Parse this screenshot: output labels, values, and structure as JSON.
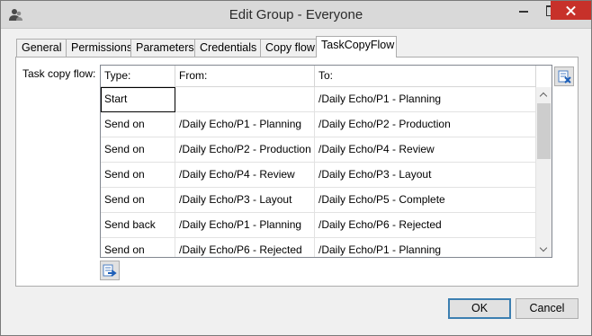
{
  "window": {
    "title": "Edit Group - Everyone"
  },
  "tabs": [
    {
      "label": "General"
    },
    {
      "label": "Permissions"
    },
    {
      "label": "Parameters"
    },
    {
      "label": "Credentials"
    },
    {
      "label": "Copy flow"
    },
    {
      "label": "TaskCopyFlow",
      "active": true
    }
  ],
  "task_copy_flow": {
    "label": "Task copy flow:",
    "columns": [
      "Type:",
      "From:",
      "To:"
    ],
    "rows": [
      {
        "type": "Start",
        "from": "",
        "to": "/Daily Echo/P1 - Planning"
      },
      {
        "type": "Send on",
        "from": "/Daily Echo/P1 - Planning",
        "to": "/Daily Echo/P2 - Production"
      },
      {
        "type": "Send on",
        "from": "/Daily Echo/P2 - Production",
        "to": "/Daily Echo/P4 - Review"
      },
      {
        "type": "Send on",
        "from": "/Daily Echo/P4 - Review",
        "to": "/Daily Echo/P3 - Layout"
      },
      {
        "type": "Send on",
        "from": "/Daily Echo/P3 - Layout",
        "to": "/Daily Echo/P5 - Complete"
      },
      {
        "type": "Send back",
        "from": "/Daily Echo/P1 - Planning",
        "to": "/Daily Echo/P6 - Rejected"
      },
      {
        "type": "Send on",
        "from": "/Daily Echo/P6 - Rejected",
        "to": "/Daily Echo/P1 - Planning"
      }
    ]
  },
  "icons": {
    "app": "users-icon",
    "delete_row": "delete-row-icon",
    "add_row": "add-row-icon"
  },
  "buttons": {
    "ok_label": "OK",
    "cancel_label": "Cancel"
  },
  "colors": {
    "close_button": "#c7312a",
    "default_button_border": "#3c7fb1"
  }
}
